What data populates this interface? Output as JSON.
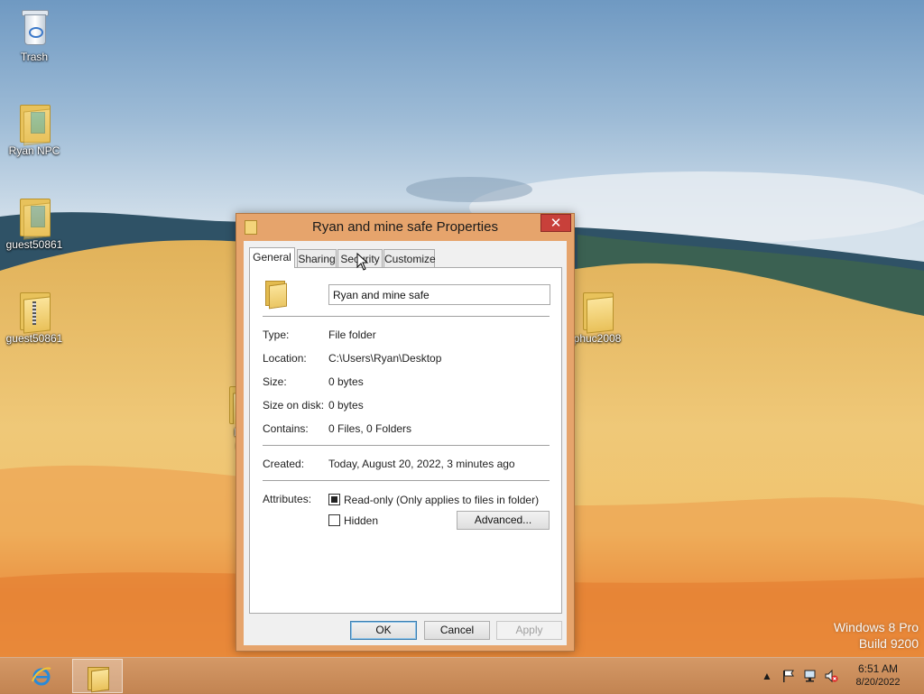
{
  "desktop": {
    "icons": [
      {
        "label": "Trash"
      },
      {
        "label": "Ryan NPC"
      },
      {
        "label": "guest50861"
      },
      {
        "label": "guest50861"
      },
      {
        "label": "phuc2008"
      },
      {
        "label": "Ry mi"
      }
    ],
    "watermark": {
      "line1": "Windows 8 Pro",
      "line2": "Build 9200"
    }
  },
  "dialog": {
    "title": "Ryan and mine safe Properties",
    "close_label": "✕",
    "tabs": [
      "General",
      "Sharing",
      "Security",
      "Customize"
    ],
    "active_tab": "General",
    "folder_name": "Ryan and mine safe",
    "properties": [
      {
        "label": "Type:",
        "value": "File folder"
      },
      {
        "label": "Location:",
        "value": "C:\\Users\\Ryan\\Desktop"
      },
      {
        "label": "Size:",
        "value": "0 bytes"
      },
      {
        "label": "Size on disk:",
        "value": "0 bytes"
      },
      {
        "label": "Contains:",
        "value": "0 Files, 0 Folders"
      }
    ],
    "created": {
      "label": "Created:",
      "value": "Today, August 20, 2022, 3 minutes ago"
    },
    "attributes": {
      "label": "Attributes:",
      "readonly_label": "Read-only (Only applies to files in folder)",
      "readonly_state": "indeterminate",
      "hidden_label": "Hidden",
      "hidden_checked": false,
      "advanced_label": "Advanced..."
    },
    "buttons": {
      "ok": "OK",
      "cancel": "Cancel",
      "apply": "Apply"
    }
  },
  "taskbar": {
    "pinned": [
      "internet-explorer-icon",
      "file-explorer-icon"
    ],
    "tray": [
      "show-hidden-icons-chevron",
      "action-center-flag-icon",
      "network-icon",
      "speaker-muted-icon"
    ],
    "time": "6:51 AM",
    "date": "8/20/2022"
  },
  "colors": {
    "window_frame": "#e6a46c",
    "close_button": "#c8403a",
    "taskbar": "#c9874f"
  }
}
